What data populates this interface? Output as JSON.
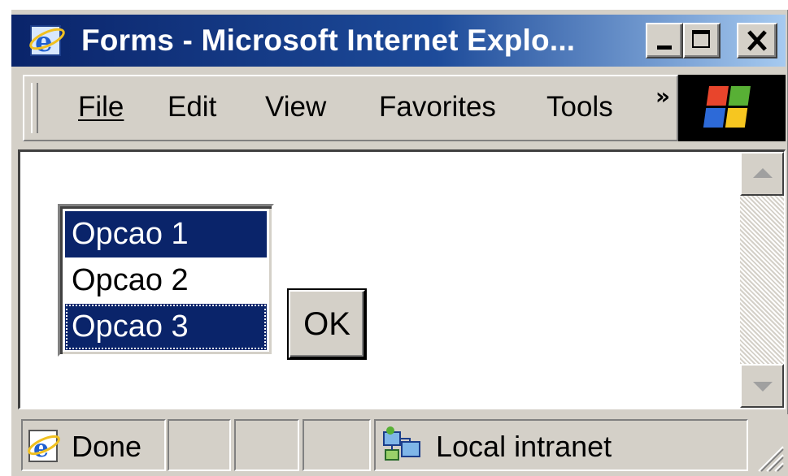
{
  "window": {
    "title": "Forms - Microsoft Internet Explo...",
    "title_icon": "ie-icon",
    "controls": [
      "minimize",
      "maximize",
      "close"
    ]
  },
  "menubar": {
    "items": [
      {
        "label": "File"
      },
      {
        "label": "Edit"
      },
      {
        "label": "View"
      },
      {
        "label": "Favorites"
      },
      {
        "label": "Tools"
      }
    ],
    "overflow": "»",
    "logo": "windows-logo-icon"
  },
  "form": {
    "listbox": {
      "options": [
        {
          "label": "Opcao 1",
          "selected": true
        },
        {
          "label": "Opcao 2",
          "selected": false
        },
        {
          "label": "Opcao 3",
          "selected": true,
          "focused": true
        }
      ]
    },
    "ok_label": "OK"
  },
  "statusbar": {
    "status": "Done",
    "zone": "Local intranet",
    "status_icon": "ie-page-icon",
    "zone_icon": "local-intranet-icon"
  },
  "colors": {
    "titlebar_start": "#0a246a",
    "titlebar_end": "#a6caf0",
    "selection": "#0a246a",
    "face": "#d4d0c8"
  }
}
